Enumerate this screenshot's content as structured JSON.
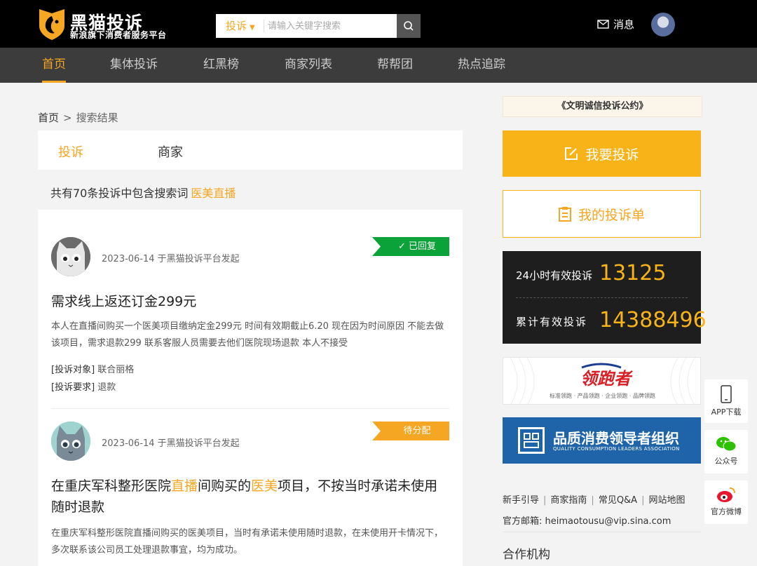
{
  "header": {
    "logo_title": "黑猫投诉",
    "logo_subtitle": "新浪旗下消费者服务平台",
    "search_type": "投诉",
    "search_placeholder": "请输入关键字搜索",
    "messages_label": "消息"
  },
  "nav": {
    "items": [
      {
        "label": "首页",
        "active": true
      },
      {
        "label": "集体投诉"
      },
      {
        "label": "红黑榜"
      },
      {
        "label": "商家列表"
      },
      {
        "label": "帮帮团"
      },
      {
        "label": "热点追踪"
      }
    ]
  },
  "breadcrumb": {
    "home": "首页",
    "separator": ">",
    "current": "搜索结果"
  },
  "tabs": [
    {
      "label": "投诉",
      "active": true
    },
    {
      "label": "商家"
    }
  ],
  "summary": {
    "text": "共有70条投诉中包含搜索词",
    "keyword": "医美直播"
  },
  "results": [
    {
      "meta": "2023-06-14 于黑猫投诉平台发起",
      "status": "已回复",
      "title": "需求线上返还订金299元",
      "description": "本人在直播间购买一个医美项目缴纳定金299元 时间有效期截止6.20 现在因为时间原因 不能去做该项目，需求退款299 联系客服人员需要去他们医院现场退款 本人不接受",
      "target_label": "[投诉对象]",
      "target_value": "联合丽格",
      "request_label": "[投诉要求]",
      "request_value": "退款"
    },
    {
      "meta": "2023-06-14 于黑猫投诉平台发起",
      "status": "待分配",
      "title_parts": [
        "在重庆军科整形医院",
        "直播",
        "间购买的",
        "医美",
        "项目，不按当时承诺未使用随时退款"
      ],
      "description": "在重庆军科整形医院直播间购买的医美项目，当时有承诺未使用随时退款，在未使用开卡情况下，多次联系该公司员工处理退款事宜，均为成功。"
    }
  ],
  "sidebar": {
    "pledge": "《文明诚信投诉公约》",
    "complain_button": "我要投诉",
    "my_list_button": "我的投诉单",
    "stats": [
      {
        "label": "24小时有效投诉",
        "value": "13125"
      },
      {
        "label": "累计有效投诉",
        "value": "14388496"
      }
    ],
    "ad_lead": {
      "mark": "领跑者",
      "sub": "标准领跑 · 产品领跑 · 企业领跑 · 品牌领跑"
    },
    "ad_quality": {
      "title": "品质消费领导者组织",
      "sub": "QUALITY CONSUMPTION LEADERS ASSOCIATION"
    },
    "links": [
      "新手引导",
      "商家指南",
      "常见Q&A",
      "网站地图"
    ],
    "email": "官方邮箱: heimaotousu@vip.sina.com",
    "partners_title": "合作机构"
  },
  "floating": [
    {
      "label": "APP下载",
      "icon": "phone-icon"
    },
    {
      "label": "公众号",
      "icon": "wechat-icon"
    },
    {
      "label": "官方微博",
      "icon": "weibo-icon"
    }
  ],
  "colors": {
    "accent": "#f5a623",
    "green": "#0ca23a",
    "dark": "#1e1e1e",
    "nav": "#3c3c3c"
  }
}
